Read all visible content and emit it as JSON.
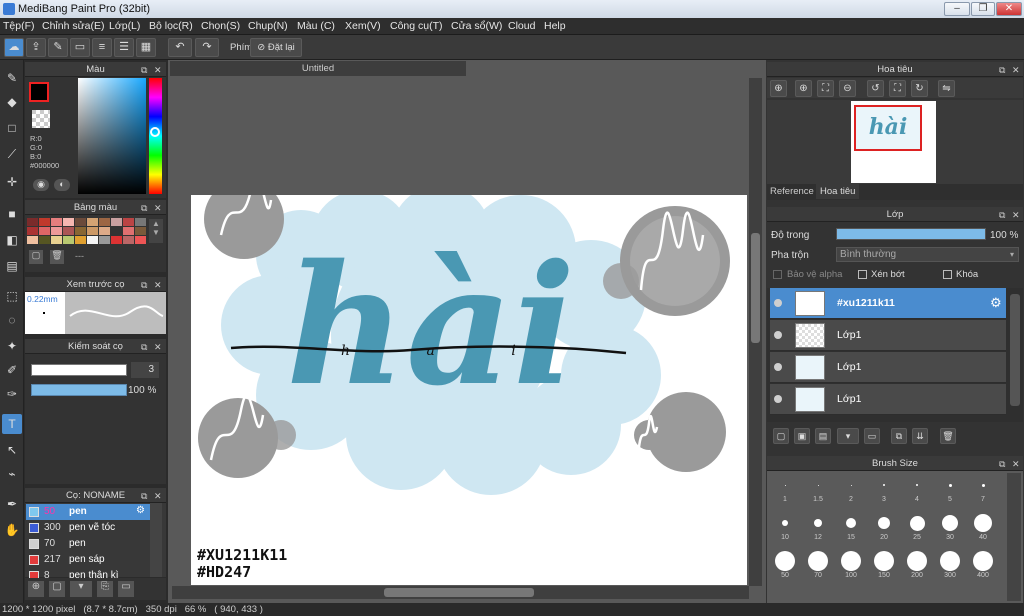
{
  "window": {
    "title": "MediBang Paint Pro (32bit)"
  },
  "menu": [
    "Tệp(F)",
    "Chỉnh sửa(E)",
    "Lớp(L)",
    "Bộ lọc(R)",
    "Chọn(S)",
    "Chụp(N)",
    "Màu (C)",
    "Xem(V)",
    "Công cụ(T)",
    "Cửa sổ(W)",
    "Cloud",
    "Help"
  ],
  "toolbar": {
    "phim_label": "Phím",
    "reset_label": "Đặt lại"
  },
  "color_panel": {
    "title": "Màu",
    "r": "R:0",
    "g": "G:0",
    "b": "B:0",
    "hex": "#000000"
  },
  "palette_panel": {
    "title": "Bảng màu",
    "dash": "---"
  },
  "preview_panel": {
    "title": "Xem trước cọ",
    "size": "0.22mm"
  },
  "brush_control": {
    "title": "Kiểm soát cọ",
    "size_value": "3",
    "opacity_value": "100 %"
  },
  "brush_list": {
    "title": "Cọ: NONAME",
    "items": [
      {
        "num": "50",
        "name": "pen",
        "color": "#7fc8ee",
        "selected": true
      },
      {
        "num": "300",
        "name": "pen vẽ tóc",
        "color": "#3b5cd6",
        "selected": false
      },
      {
        "num": "70",
        "name": "pen",
        "color": "#cfcfcf",
        "selected": false
      },
      {
        "num": "217",
        "name": "pen sáp",
        "color": "#e23b3b",
        "selected": false
      },
      {
        "num": "8",
        "name": "pen thân kì",
        "color": "#e23b3b",
        "selected": false
      }
    ]
  },
  "document": {
    "tab": "Untitled",
    "art_text": "hài",
    "small_text": "h a i",
    "tag1": "#XU1211K11",
    "tag2": "#HD247"
  },
  "navigator": {
    "title": "Hoa tiêu",
    "tab_reference": "Reference",
    "tab_navigator": "Hoa tiêu",
    "thumb_text": "hài"
  },
  "layer_panel": {
    "title": "Lớp",
    "opacity_label": "Độ trong",
    "opacity_value": "100 %",
    "opacity_fraction": 1.0,
    "blend_label": "Pha trộn",
    "blend_value": "Bình thường",
    "protect_alpha": "Bảo vệ alpha",
    "clipping": "Xén bớt",
    "lock": "Khóa",
    "layers": [
      {
        "name": "#xu1211k11",
        "selected": true
      },
      {
        "name": "Lớp1",
        "selected": false
      },
      {
        "name": "Lớp1",
        "selected": false
      },
      {
        "name": "Lớp1",
        "selected": false
      }
    ]
  },
  "brush_size": {
    "title": "Brush Size",
    "sizes": [
      "1",
      "1.5",
      "2",
      "3",
      "4",
      "5",
      "7",
      "10",
      "12",
      "15",
      "20",
      "25",
      "30",
      "40",
      "50",
      "70",
      "100",
      "150",
      "200",
      "300",
      "400"
    ]
  },
  "status": {
    "text": "1200 * 1200 pixel   (8.7 * 8.7cm)   350 dpi   66 %   ( 940, 433 )"
  },
  "colors": {
    "accent": "#4a8ccf",
    "art_teal": "#4a98b3",
    "cloud": "#cfe7f2",
    "circle": "#9a9a9a"
  }
}
